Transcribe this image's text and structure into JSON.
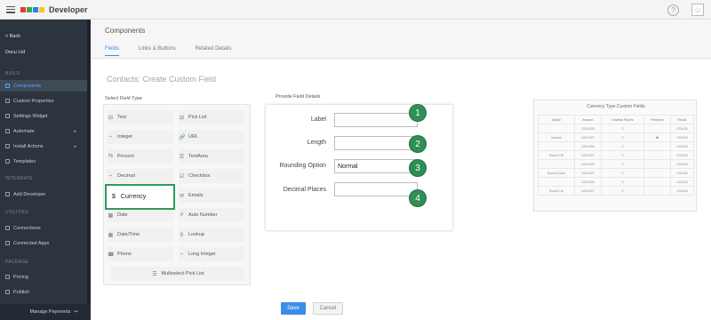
{
  "app": {
    "brand": "Developer",
    "logo_colors": [
      "#e53935",
      "#43a047",
      "#1e88e5",
      "#fbc02d"
    ],
    "help_icon": "?",
    "user_icon": "user-icon"
  },
  "sidebar": {
    "back": "< Back",
    "org": "Docu Ltd",
    "sections": {
      "build": "BUILD",
      "integrate": "INTEGRATE",
      "utilities": "UTILITIES",
      "package": "PACKAGE"
    },
    "items": [
      {
        "label": "Components",
        "active": true
      },
      {
        "label": "Custom Properties"
      },
      {
        "label": "Settings Widget"
      },
      {
        "label": "Automate",
        "arrow": "▸"
      },
      {
        "label": "Install Actions",
        "arrow": "▸"
      },
      {
        "label": "Templates"
      },
      {
        "label": "Add Developer"
      },
      {
        "label": "Connections"
      },
      {
        "label": "Connected Apps"
      },
      {
        "label": "Pricing"
      },
      {
        "label": "Publish"
      }
    ],
    "bottom": "Manage Payments"
  },
  "page": {
    "title": "Components",
    "tabs": [
      "Fields",
      "Links & Buttons",
      "Related Details"
    ],
    "form_title": "Contacts: Create Custom Field"
  },
  "field_types": {
    "label": "Select Field Type",
    "items": [
      {
        "icon": "⊟",
        "label": "Text"
      },
      {
        "icon": "⊟",
        "label": "Pick List"
      },
      {
        "icon": "⇔",
        "label": "Integer"
      },
      {
        "icon": "🔗",
        "label": "URL"
      },
      {
        "icon": "%",
        "label": "Percent"
      },
      {
        "icon": "☰",
        "label": "TextArea"
      },
      {
        "icon": "⇔",
        "label": "Decimal"
      },
      {
        "icon": "☑",
        "label": "Checkbox"
      },
      {
        "icon": "$",
        "label": "Currency"
      },
      {
        "icon": "✉",
        "label": "Emails"
      },
      {
        "icon": "▦",
        "label": "Date"
      },
      {
        "icon": "#",
        "label": "Auto Number"
      },
      {
        "icon": "▦",
        "label": "Date/Time"
      },
      {
        "icon": "⚲",
        "label": "Lookup"
      },
      {
        "icon": "☎",
        "label": "Phone"
      },
      {
        "icon": "⇔",
        "label": "Long Integer"
      }
    ],
    "multi": "Multiselect Pick List"
  },
  "details": {
    "label": "Provide Field Details",
    "rows": [
      {
        "label": "Label",
        "value": "",
        "badge": "1"
      },
      {
        "label": "Length",
        "value": "",
        "badge": "2"
      },
      {
        "label": "Rounding Option",
        "value": "Normal",
        "badge": "3"
      },
      {
        "label": "Decimal Places",
        "value": "",
        "badge": "4"
      }
    ]
  },
  "reference": {
    "title": "Currency Type Custom Fields",
    "headers": [
      "Option",
      "Amount",
      "Decimal Places",
      "Precision",
      "Result"
    ],
    "rows": [
      [
        "",
        "1234.525",
        "2",
        "",
        "1234.52"
      ],
      [
        "Normal",
        "1234.527",
        "2",
        "✖",
        "1234.53"
      ],
      [
        "",
        "1234.525",
        "2",
        "",
        "1234.53"
      ],
      [
        "Round Off",
        "1234.527",
        "2",
        "",
        "1234.53"
      ],
      [
        "",
        "1234.525",
        "2",
        "",
        "1234.53"
      ],
      [
        "Round Down",
        "1234.527",
        "2",
        "",
        "1234.52"
      ],
      [
        "",
        "1234.525",
        "2",
        "",
        "1234.53"
      ],
      [
        "Round Up",
        "1234.527",
        "2",
        "",
        "1234.53"
      ]
    ]
  },
  "buttons": {
    "save": "Save",
    "cancel": "Cancel"
  }
}
